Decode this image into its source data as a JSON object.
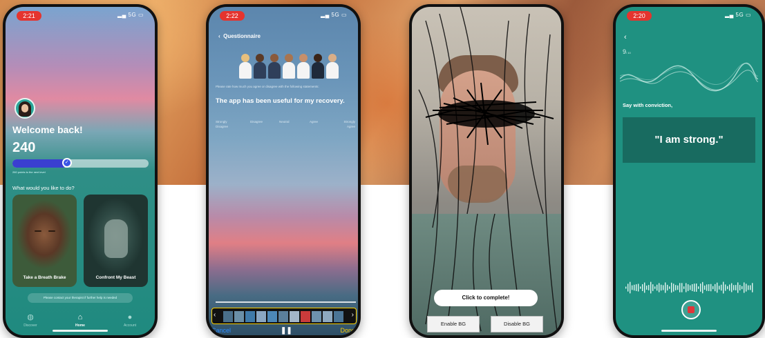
{
  "colors": {
    "teal": "#1f9181",
    "record": "#e0363a",
    "progress": "#3a3fd0",
    "done": "#ffcc00",
    "cancel": "#2c8cff"
  },
  "phone1": {
    "status": {
      "time": "2:21",
      "signal": "5G"
    },
    "welcome": "Welcome back!",
    "points": "240",
    "progress_fraction": 0.4,
    "progress_note": "260 points to the next level",
    "prompt": "What would you like to do?",
    "cards": [
      {
        "label": "Take a Breath Brake"
      },
      {
        "label": "Confront My Beast"
      }
    ],
    "contact_note": "Please contact your therapist if further help is needed",
    "tabs": [
      {
        "label": "Discover",
        "icon": "globe-icon"
      },
      {
        "label": "Home",
        "icon": "home-icon",
        "active": true
      },
      {
        "label": "Account",
        "icon": "user-icon"
      }
    ]
  },
  "phone2": {
    "status": {
      "time": "2:22",
      "signal": "5G"
    },
    "back_label": "Questionnaire",
    "instructions": "Please rate how much you agree or disagree with the following statements:",
    "question": "The app has been useful for my recovery.",
    "scale": [
      "Strongly Disagree",
      "Disagree",
      "Neutral",
      "Agree",
      "Strongly Agree"
    ],
    "controls": {
      "cancel": "Cancel",
      "done": "Done"
    }
  },
  "phone3": {
    "complete_label": "Click to complete!",
    "enable_label": "Enable BG",
    "disable_label": "Disable BG"
  },
  "phone4": {
    "status": {
      "time": "2:20",
      "signal": "5G"
    },
    "count": "9",
    "count_unit": "/ 10",
    "instruction": "Say with conviction,",
    "affirmation": "\"I am strong.\""
  }
}
